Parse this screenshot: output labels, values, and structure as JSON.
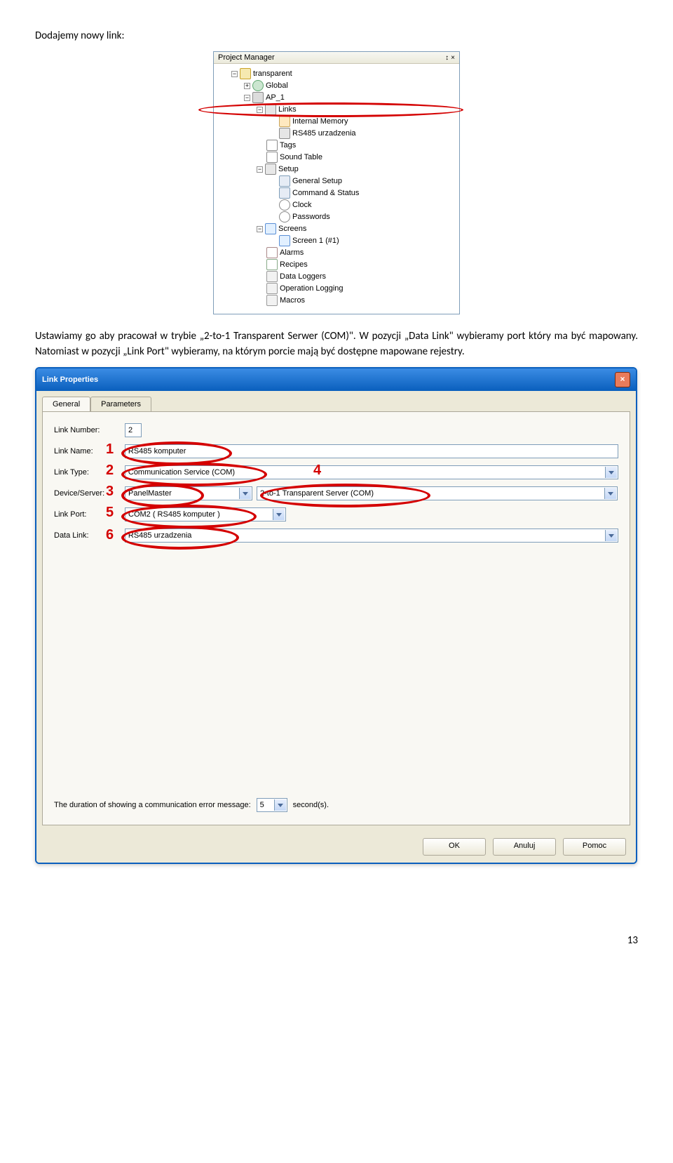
{
  "body": {
    "heading": "Dodajemy nowy link:",
    "paragraph": "Ustawiamy go aby pracował w trybie „2-to-1 Transparent Serwer (COM)\". W pozycji „Data Link\" wybieramy port który ma być mapowany. Natomiast w pozycji „Link Port\" wybieramy, na którym porcie mają być dostępne mapowane rejestry.",
    "page_number": "13"
  },
  "project_manager": {
    "title": "Project Manager",
    "pin_symbol": "↕",
    "close_symbol": "×",
    "nodes": {
      "root": "transparent",
      "global": "Global",
      "ap1": "AP_1",
      "links": "Links",
      "internal_memory": "Internal Memory",
      "rs485_urzadzenia": "RS485 urzadzenia",
      "tags": "Tags",
      "sound_table": "Sound Table",
      "setup": "Setup",
      "general_setup": "General Setup",
      "command_status": "Command & Status",
      "clock": "Clock",
      "passwords": "Passwords",
      "screens": "Screens",
      "screen1": "Screen 1 (#1)",
      "alarms": "Alarms",
      "recipes": "Recipes",
      "data_loggers": "Data Loggers",
      "operation_logging": "Operation Logging",
      "macros": "Macros"
    }
  },
  "dialog": {
    "title": "Link Properties",
    "tab_general": "General",
    "tab_parameters": "Parameters",
    "labels": {
      "link_number": "Link Number:",
      "link_name": "Link Name:",
      "link_type": "Link Type:",
      "device_server": "Device/Server:",
      "link_port": "Link Port:",
      "data_link": "Data Link:"
    },
    "values": {
      "link_number": "2",
      "link_name": "RS485 komputer",
      "link_type": "Communication Service (COM)",
      "device_server_1": "PanelMaster",
      "device_server_2": "2-to-1 Transparent Server (COM)",
      "link_port": "COM2 ( RS485 komputer )",
      "data_link": "RS485 urzadzenia"
    },
    "annotations": {
      "n1": "1",
      "n2": "2",
      "n3": "3",
      "n4": "4",
      "n5": "5",
      "n6": "6"
    },
    "duration_label": "The duration of showing a communication error message:",
    "duration_value": "5",
    "duration_unit": "second(s).",
    "buttons": {
      "ok": "OK",
      "cancel": "Anuluj",
      "help": "Pomoc"
    }
  }
}
